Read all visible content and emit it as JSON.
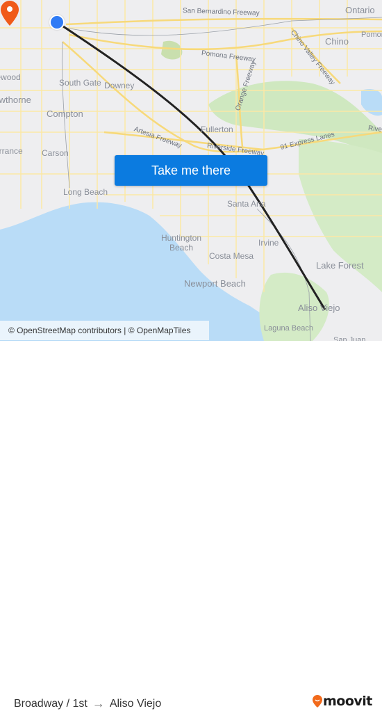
{
  "map": {
    "cities": [
      {
        "name": "Ontario",
        "id": "ontario"
      },
      {
        "name": "Chino",
        "id": "chino"
      },
      {
        "name": "Pomona",
        "id": "pomona"
      },
      {
        "name": "South Gate",
        "id": "south-gate"
      },
      {
        "name": "Downey",
        "id": "downey"
      },
      {
        "name": "Compton",
        "id": "compton"
      },
      {
        "name": "Inglewood",
        "id": "inglewood"
      },
      {
        "name": "Hawthorne",
        "id": "hawthorne"
      },
      {
        "name": "Torrance",
        "id": "torrance"
      },
      {
        "name": "Carson",
        "id": "carson"
      },
      {
        "name": "Fullerton",
        "id": "fullerton"
      },
      {
        "name": "Long Beach",
        "id": "long-beach"
      },
      {
        "name": "Santa Ana",
        "id": "santa-ana"
      },
      {
        "name": "Huntington Beach",
        "id": "huntington-beach"
      },
      {
        "name": "Irvine",
        "id": "irvine"
      },
      {
        "name": "Costa Mesa",
        "id": "costa-mesa"
      },
      {
        "name": "Newport Beach",
        "id": "newport-beach"
      },
      {
        "name": "Lake Forest",
        "id": "lake-forest"
      },
      {
        "name": "Aliso Viejo",
        "id": "aliso-viejo"
      },
      {
        "name": "Laguna Beach",
        "id": "laguna-beach"
      },
      {
        "name": "San Juan",
        "id": "san-juan"
      }
    ],
    "roads": [
      {
        "name": "San Bernardino Freeway",
        "id": "san-bernardino-freeway"
      },
      {
        "name": "Pomona Freeway",
        "id": "pomona-freeway"
      },
      {
        "name": "Chino Valley Freeway",
        "id": "chino-valley-freeway"
      },
      {
        "name": "Orange Freeway",
        "id": "orange-freeway"
      },
      {
        "name": "Artesia Freeway",
        "id": "artesia-freeway"
      },
      {
        "name": "Riverside Freeway",
        "id": "riverside-freeway"
      },
      {
        "name": "91 Express Lanes",
        "id": "91-express-lanes"
      },
      {
        "name": "Rive",
        "id": "riverside-freeway-east"
      }
    ],
    "origin_marker_color": "#2f7bf5",
    "destination_marker_color": "#f05a1a",
    "route_line_color": "#222222"
  },
  "cta": {
    "label": "Take me there",
    "color": "#0b7be0"
  },
  "attribution": "© OpenStreetMap contributors | © OpenMapTiles",
  "footer": {
    "origin": "Broadway / 1st",
    "arrow_icon": "→",
    "destination": "Aliso Viejo",
    "brand": "moovit",
    "brand_color": "#f26a1b"
  }
}
